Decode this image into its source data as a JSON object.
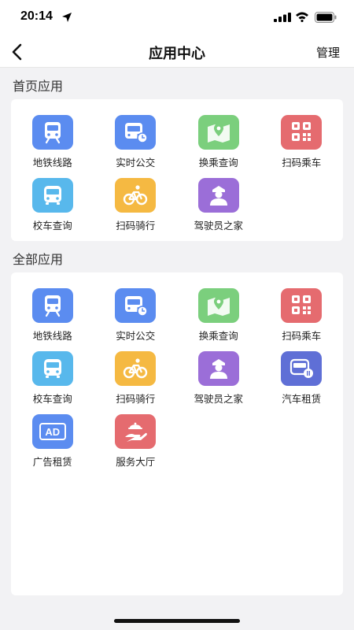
{
  "status_bar": {
    "time": "20:14"
  },
  "nav": {
    "title": "应用中心",
    "manage_label": "管理"
  },
  "home_section": {
    "title": "首页应用",
    "apps": [
      {
        "label": "地铁线路",
        "icon": "subway-icon",
        "color": "#5b8cf0"
      },
      {
        "label": "实时公交",
        "icon": "bus-clock-icon",
        "color": "#5b8cf0"
      },
      {
        "label": "换乘查询",
        "icon": "map-pin-icon",
        "color": "#7bcf7d"
      },
      {
        "label": "扫码乘车",
        "icon": "qr-code-icon",
        "color": "#e56b6f"
      },
      {
        "label": "校车查询",
        "icon": "school-bus-icon",
        "color": "#58b8ec"
      },
      {
        "label": "扫码骑行",
        "icon": "bicycle-icon",
        "color": "#f5b942"
      },
      {
        "label": "驾驶员之家",
        "icon": "driver-icon",
        "color": "#9b6ed8"
      }
    ]
  },
  "all_section": {
    "title": "全部应用",
    "apps": [
      {
        "label": "地铁线路",
        "icon": "subway-icon",
        "color": "#5b8cf0"
      },
      {
        "label": "实时公交",
        "icon": "bus-clock-icon",
        "color": "#5b8cf0"
      },
      {
        "label": "换乘查询",
        "icon": "map-pin-icon",
        "color": "#7bcf7d"
      },
      {
        "label": "扫码乘车",
        "icon": "qr-code-icon",
        "color": "#e56b6f"
      },
      {
        "label": "校车查询",
        "icon": "school-bus-icon",
        "color": "#58b8ec"
      },
      {
        "label": "扫码骑行",
        "icon": "bicycle-icon",
        "color": "#f5b942"
      },
      {
        "label": "驾驶员之家",
        "icon": "driver-icon",
        "color": "#9b6ed8"
      },
      {
        "label": "汽车租赁",
        "icon": "car-rental-icon",
        "color": "#5f6fd6"
      },
      {
        "label": "广告租赁",
        "icon": "ad-icon",
        "color": "#5b8cf0",
        "icon_text": "AD"
      },
      {
        "label": "服务大厅",
        "icon": "service-hand-icon",
        "color": "#e56b6f"
      }
    ]
  }
}
